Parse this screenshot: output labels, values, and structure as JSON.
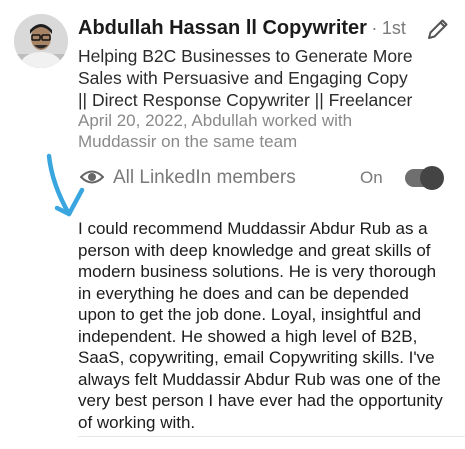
{
  "author": {
    "name": "Abdullah Hassan ll Copywriter",
    "separator": "·",
    "degree": "1st",
    "headline": "Helping B2C Businesses to Generate More Sales with Persuasive and Engaging Copy || Direct Response Copywriter || Freelancer",
    "meta": "April 20, 2022, Abdullah worked with Muddassir on the same team"
  },
  "visibility": {
    "label": "All LinkedIn members",
    "toggle_label": "On",
    "toggle_on": true
  },
  "recommendation": {
    "text": "I could recommend Muddassir Abdur Rub as a person with deep knowledge and great skills of modern business solutions. He is very thorough in everything he does and can be depended upon to get the job done. Loyal, insightful and independent. He showed a high level of B2B, SaaS, copywriting, email Copywriting skills. I've always felt Muddassir Abdur Rub was one of the very best person I have ever had the opportunity of working with."
  },
  "icons": {
    "edit": "pencil-icon",
    "visibility": "eye-icon",
    "annotation": "arrow-annotation"
  },
  "colors": {
    "arrow": "#3aa6e0",
    "toggle_track": "#6f6f6f",
    "toggle_knob": "#444444"
  }
}
